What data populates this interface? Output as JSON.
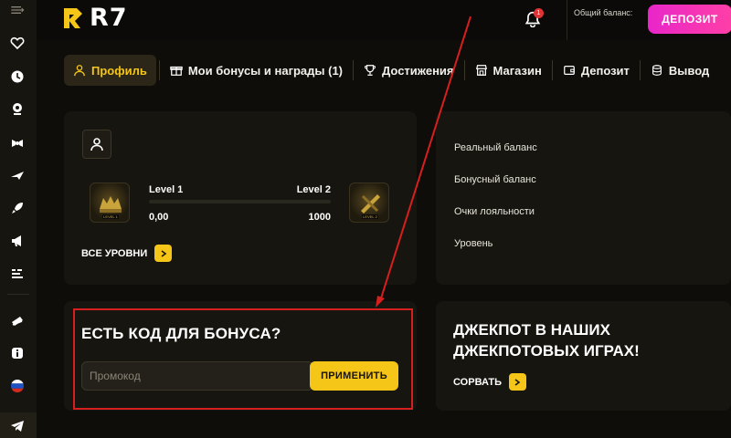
{
  "brand": {
    "logo_text": "R7"
  },
  "header": {
    "notification_count": "1",
    "balance_label": "Общий баланс:",
    "deposit_label": "ДЕПОЗИТ",
    "accent_color": "#f5c518",
    "deposit_color": "#ff2fb9"
  },
  "sidebar": {
    "icons": [
      "menu-icon",
      "heart-icon",
      "clock-icon",
      "live-casino-icon",
      "sports-icon",
      "aviator-icon",
      "rocket-icon",
      "megaphone-icon",
      "stats-icon",
      "ticket-icon",
      "info-icon",
      "russia-flag-icon",
      "telegram-icon"
    ]
  },
  "tabs": [
    {
      "label": "Профиль",
      "icon": "user-icon",
      "active": true
    },
    {
      "label": "Мои бонусы и награды (1)",
      "icon": "gift-icon"
    },
    {
      "label": "Достижения",
      "icon": "trophy-icon"
    },
    {
      "label": "Магазин",
      "icon": "shop-icon"
    },
    {
      "label": "Депозит",
      "icon": "wallet-icon"
    },
    {
      "label": "Вывод",
      "icon": "coins-icon"
    }
  ],
  "profile": {
    "level_current": "Level 1",
    "level_next": "Level 2",
    "points_current": "0,00",
    "points_target": "1000",
    "progress_fraction": 0,
    "all_levels_label": "ВСЕ УРОВНИ"
  },
  "balances": {
    "rows": [
      "Реальный баланс",
      "Бонусный баланс",
      "Очки лояльности",
      "Уровень"
    ]
  },
  "promo": {
    "title": "ЕСТЬ КОД ДЛЯ БОНУСА?",
    "placeholder": "Промокод",
    "apply_label": "ПРИМЕНИТЬ"
  },
  "jackpot": {
    "title": "ДЖЕКПОТ В НАШИХ ДЖЕКПОТОВЫХ ИГРАХ!",
    "grab_label": "СОРВАТЬ"
  }
}
